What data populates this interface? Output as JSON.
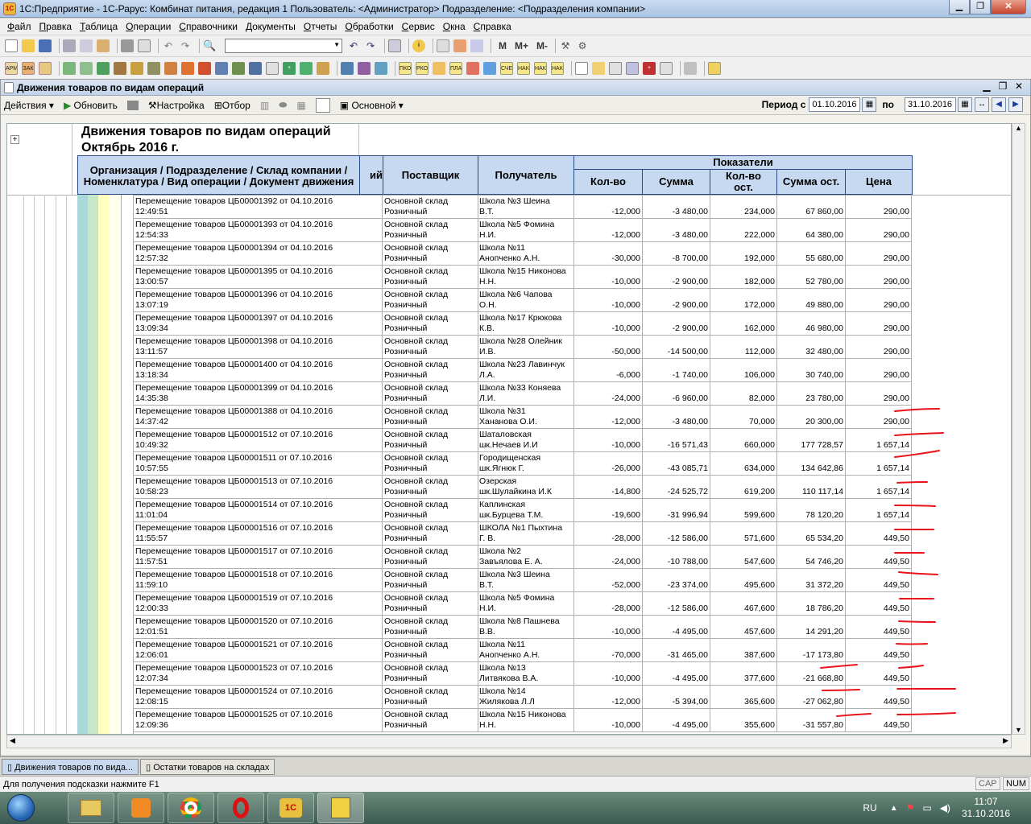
{
  "window": {
    "title": "1С:Предприятие - 1С-Рарус: Комбинат питания, редакция 1    Пользователь: <Администратор>    Подразделение: <Подразделения компании>",
    "logo": "1С"
  },
  "menu": [
    "Файл",
    "Правка",
    "Таблица",
    "Операции",
    "Справочники",
    "Документы",
    "Отчеты",
    "Обработки",
    "Сервис",
    "Окна",
    "Справка"
  ],
  "toolbar1": {
    "m_labels": [
      "M",
      "M+",
      "M-"
    ]
  },
  "toolbar2": {
    "doc_icons": [
      "ПКО",
      "РКО",
      "ПЛАТ",
      "СЧЕТ",
      "НАКЛ",
      "НАКЛ",
      "НАКЛ"
    ]
  },
  "doc": {
    "title": "Движения товаров по видам операций",
    "actions": "Действия",
    "refresh": "Обновить",
    "settings": "Настройка",
    "filter": "Отбор",
    "variant": "Основной",
    "period_from_label": "Период с",
    "period_from": "01.10.2016",
    "period_to_label": "по",
    "period_to": "31.10.2016"
  },
  "report": {
    "title": "Движения товаров по видам операций",
    "subtitle": "Октябрь 2016 г.",
    "col_group": "Организация / Подразделение / Склад компании / Номенклатура / Вид операции / Документ движения",
    "col_hidden_tail": "ий",
    "col_supplier": "Поставщик",
    "col_receiver": "Получатель",
    "indicators": "Показатели",
    "col_qty": "Кол-во",
    "col_sum": "Сумма",
    "col_qty_rest": "Кол-во ост.",
    "col_sum_rest": "Сумма ост.",
    "col_price": "Цена",
    "rows": [
      {
        "doc": "Перемещение товаров ЦБ00001392 от 04.10.2016",
        "time": "12:49:51",
        "sup1": "Основной склад",
        "sup2": "Розничный",
        "rec1": "Школа №3 Шеина",
        "rec2": "В.Т.",
        "qty": "-12,000",
        "sum": "-3 480,00",
        "qr": "234,000",
        "sr": "67 860,00",
        "price": "290,00"
      },
      {
        "doc": "Перемещение товаров ЦБ00001393 от 04.10.2016",
        "time": "12:54:33",
        "sup1": "Основной склад",
        "sup2": "Розничный",
        "rec1": "Школа №5 Фомина",
        "rec2": "Н.И.",
        "qty": "-12,000",
        "sum": "-3 480,00",
        "qr": "222,000",
        "sr": "64 380,00",
        "price": "290,00"
      },
      {
        "doc": "Перемещение товаров ЦБ00001394 от 04.10.2016",
        "time": "12:57:32",
        "sup1": "Основной склад",
        "sup2": "Розничный",
        "rec1": "Школа №11",
        "rec2": "Анопченко А.Н.",
        "qty": "-30,000",
        "sum": "-8 700,00",
        "qr": "192,000",
        "sr": "55 680,00",
        "price": "290,00"
      },
      {
        "doc": "Перемещение товаров ЦБ00001395 от 04.10.2016",
        "time": "13:00:57",
        "sup1": "Основной склад",
        "sup2": "Розничный",
        "rec1": "Школа №15 Никонова",
        "rec2": "Н.Н.",
        "qty": "-10,000",
        "sum": "-2 900,00",
        "qr": "182,000",
        "sr": "52 780,00",
        "price": "290,00"
      },
      {
        "doc": "Перемещение товаров ЦБ00001396 от 04.10.2016",
        "time": "13:07:19",
        "sup1": "Основной склад",
        "sup2": "Розничный",
        "rec1": "Школа №6 Чапова",
        "rec2": "О.Н.",
        "qty": "-10,000",
        "sum": "-2 900,00",
        "qr": "172,000",
        "sr": "49 880,00",
        "price": "290,00"
      },
      {
        "doc": "Перемещение товаров ЦБ00001397 от 04.10.2016",
        "time": "13:09:34",
        "sup1": "Основной склад",
        "sup2": "Розничный",
        "rec1": "Школа №17 Крюкова",
        "rec2": "К.В.",
        "qty": "-10,000",
        "sum": "-2 900,00",
        "qr": "162,000",
        "sr": "46 980,00",
        "price": "290,00"
      },
      {
        "doc": "Перемещение товаров ЦБ00001398 от 04.10.2016",
        "time": "13:11:57",
        "sup1": "Основной склад",
        "sup2": "Розничный",
        "rec1": "Школа №28 Олейник",
        "rec2": "И.В.",
        "qty": "-50,000",
        "sum": "-14 500,00",
        "qr": "112,000",
        "sr": "32 480,00",
        "price": "290,00"
      },
      {
        "doc": "Перемещение товаров ЦБ00001400 от 04.10.2016",
        "time": "13:18:34",
        "sup1": "Основной склад",
        "sup2": "Розничный",
        "rec1": "Школа №23 Лавинчук",
        "rec2": "Л.А.",
        "qty": "-6,000",
        "sum": "-1 740,00",
        "qr": "106,000",
        "sr": "30 740,00",
        "price": "290,00"
      },
      {
        "doc": "Перемещение товаров ЦБ00001399 от 04.10.2016",
        "time": "14:35:38",
        "sup1": "Основной склад",
        "sup2": "Розничный",
        "rec1": "Школа №33 Коняева",
        "rec2": "Л.И.",
        "qty": "-24,000",
        "sum": "-6 960,00",
        "qr": "82,000",
        "sr": "23 780,00",
        "price": "290,00"
      },
      {
        "doc": "Перемещение товаров ЦБ00001388 от 04.10.2016",
        "time": "14:37:42",
        "sup1": "Основной склад",
        "sup2": "Розничный",
        "rec1": "Школа №31",
        "rec2": "Хананова О.И.",
        "qty": "-12,000",
        "sum": "-3 480,00",
        "qr": "70,000",
        "sr": "20 300,00",
        "price": "290,00"
      },
      {
        "doc": "Перемещение товаров ЦБ00001512 от 07.10.2016",
        "time": "10:49:32",
        "sup1": "Основной склад",
        "sup2": "Розничный",
        "rec1": "Шаталовская",
        "rec2": "шк.Нечаев И.И",
        "qty": "-10,000",
        "sum": "-16 571,43",
        "qr": "660,000",
        "sr": "177 728,57",
        "price": "1 657,14"
      },
      {
        "doc": "Перемещение товаров ЦБ00001511 от 07.10.2016",
        "time": "10:57:55",
        "sup1": "Основной склад",
        "sup2": "Розничный",
        "rec1": "Городищенская",
        "rec2": "шк.Ягнюк Г.",
        "qty": "-26,000",
        "sum": "-43 085,71",
        "qr": "634,000",
        "sr": "134 642,86",
        "price": "1 657,14"
      },
      {
        "doc": "Перемещение товаров ЦБ00001513 от 07.10.2016",
        "time": "10:58:23",
        "sup1": "Основной склад",
        "sup2": "Розничный",
        "rec1": "Озерская",
        "rec2": "шк.Шулайкина И.К",
        "qty": "-14,800",
        "sum": "-24 525,72",
        "qr": "619,200",
        "sr": "110 117,14",
        "price": "1 657,14"
      },
      {
        "doc": "Перемещение товаров ЦБ00001514 от 07.10.2016",
        "time": "11:01:04",
        "sup1": "Основной склад",
        "sup2": "Розничный",
        "rec1": "Каплинская",
        "rec2": "шк.Бурцева Т.М.",
        "qty": "-19,600",
        "sum": "-31 996,94",
        "qr": "599,600",
        "sr": "78 120,20",
        "price": "1 657,14"
      },
      {
        "doc": "Перемещение товаров ЦБ00001516 от 07.10.2016",
        "time": "11:55:57",
        "sup1": "Основной склад",
        "sup2": "Розничный",
        "rec1": "ШКОЛА №1 Пыхтина",
        "rec2": "Г. В.",
        "qty": "-28,000",
        "sum": "-12 586,00",
        "qr": "571,600",
        "sr": "65 534,20",
        "price": "449,50"
      },
      {
        "doc": "Перемещение товаров ЦБ00001517 от 07.10.2016",
        "time": "11:57:51",
        "sup1": "Основной склад",
        "sup2": "Розничный",
        "rec1": "Школа №2",
        "rec2": "Завъялова Е. А.",
        "qty": "-24,000",
        "sum": "-10 788,00",
        "qr": "547,600",
        "sr": "54 746,20",
        "price": "449,50"
      },
      {
        "doc": "Перемещение товаров ЦБ00001518 от 07.10.2016",
        "time": "11:59:10",
        "sup1": "Основной склад",
        "sup2": "Розничный",
        "rec1": "Школа №3 Шеина",
        "rec2": "В.Т.",
        "qty": "-52,000",
        "sum": "-23 374,00",
        "qr": "495,600",
        "sr": "31 372,20",
        "price": "449,50"
      },
      {
        "doc": "Перемещение товаров ЦБ00001519 от 07.10.2016",
        "time": "12:00:33",
        "sup1": "Основной склад",
        "sup2": "Розничный",
        "rec1": "Школа №5 Фомина",
        "rec2": "Н.И.",
        "qty": "-28,000",
        "sum": "-12 586,00",
        "qr": "467,600",
        "sr": "18 786,20",
        "price": "449,50"
      },
      {
        "doc": "Перемещение товаров ЦБ00001520 от 07.10.2016",
        "time": "12:01:51",
        "sup1": "Основной склад",
        "sup2": "Розничный",
        "rec1": "Школа №8 Пашнева",
        "rec2": "В.В.",
        "qty": "-10,000",
        "sum": "-4 495,00",
        "qr": "457,600",
        "sr": "14 291,20",
        "price": "449,50"
      },
      {
        "doc": "Перемещение товаров ЦБ00001521 от 07.10.2016",
        "time": "12:06:01",
        "sup1": "Основной склад",
        "sup2": "Розничный",
        "rec1": "Школа №11",
        "rec2": "Анопченко А.Н.",
        "qty": "-70,000",
        "sum": "-31 465,00",
        "qr": "387,600",
        "sr": "-17 173,80",
        "price": "449,50"
      },
      {
        "doc": "Перемещение товаров ЦБ00001523 от 07.10.2016",
        "time": "12:07:34",
        "sup1": "Основной склад",
        "sup2": "Розничный",
        "rec1": "Школа №13",
        "rec2": "Литвякова В.А.",
        "qty": "-10,000",
        "sum": "-4 495,00",
        "qr": "377,600",
        "sr": "-21 668,80",
        "price": "449,50"
      },
      {
        "doc": "Перемещение товаров ЦБ00001524 от 07.10.2016",
        "time": "12:08:15",
        "sup1": "Основной склад",
        "sup2": "Розничный",
        "rec1": "Школа №14",
        "rec2": "Жилякова Л.Л",
        "qty": "-12,000",
        "sum": "-5 394,00",
        "qr": "365,600",
        "sr": "-27 062,80",
        "price": "449,50"
      },
      {
        "doc": "Перемещение товаров ЦБ00001525 от 07.10.2016",
        "time": "12:09:36",
        "sup1": "Основной склад",
        "sup2": "Розничный",
        "rec1": "Школа №15 Никонова",
        "rec2": "Н.Н.",
        "qty": "-10,000",
        "sum": "-4 495,00",
        "qr": "355,600",
        "sr": "-31 557,80",
        "price": "449,50"
      }
    ]
  },
  "tabs": [
    "Движения товаров по вида...",
    "Остатки товаров на складах"
  ],
  "status": {
    "hint": "Для получения подсказки нажмите F1",
    "cap": "CAP",
    "num": "NUM"
  },
  "taskbar": {
    "lang": "RU",
    "time": "11:07",
    "date": "31.10.2016"
  },
  "colors": {
    "header_bg": "#c6d9f0",
    "annotation": "#e8141a"
  }
}
